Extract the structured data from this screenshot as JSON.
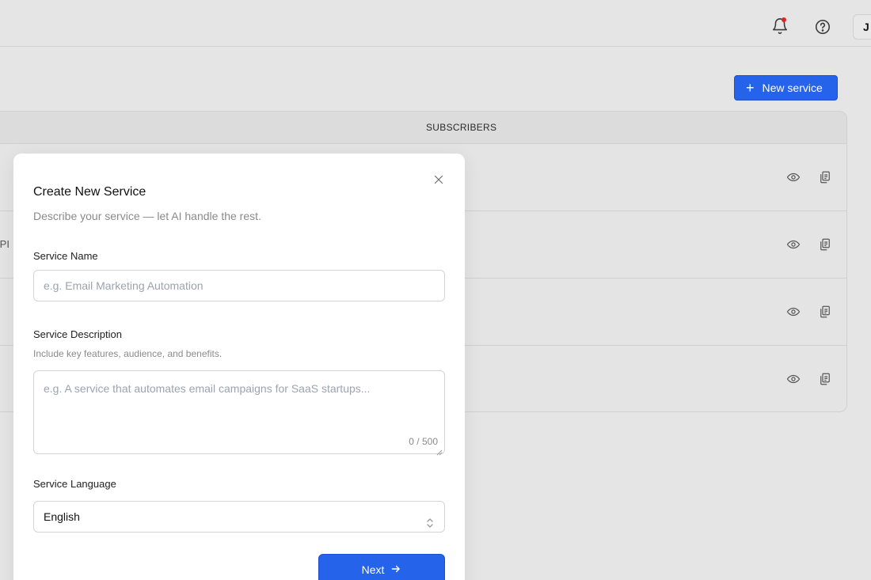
{
  "header": {
    "avatar_initial": "J",
    "notification_indicator": true
  },
  "toolbar": {
    "new_service_label": "New service"
  },
  "table": {
    "columns": [
      "SUBSCRIBERS"
    ],
    "rows": [
      {
        "partial_text": ""
      },
      {
        "partial_text": "API"
      },
      {
        "partial_text": ""
      },
      {
        "partial_text": ""
      }
    ]
  },
  "modal": {
    "title": "Create New Service",
    "subtitle": "Describe your service — let AI handle the rest.",
    "name_label": "Service Name",
    "name_placeholder": "e.g. Email Marketing Automation",
    "description_label": "Service Description",
    "description_hint": "Include key features, audience, and benefits.",
    "description_placeholder": "e.g. A service that automates email campaigns for SaaS startups...",
    "description_counter": "0 / 500",
    "language_label": "Service Language",
    "language_value": "English",
    "next_label": "Next"
  },
  "colors": {
    "accent": "#2563eb",
    "notification": "#dc2626",
    "overlay_bg": "#e5e5e5"
  }
}
